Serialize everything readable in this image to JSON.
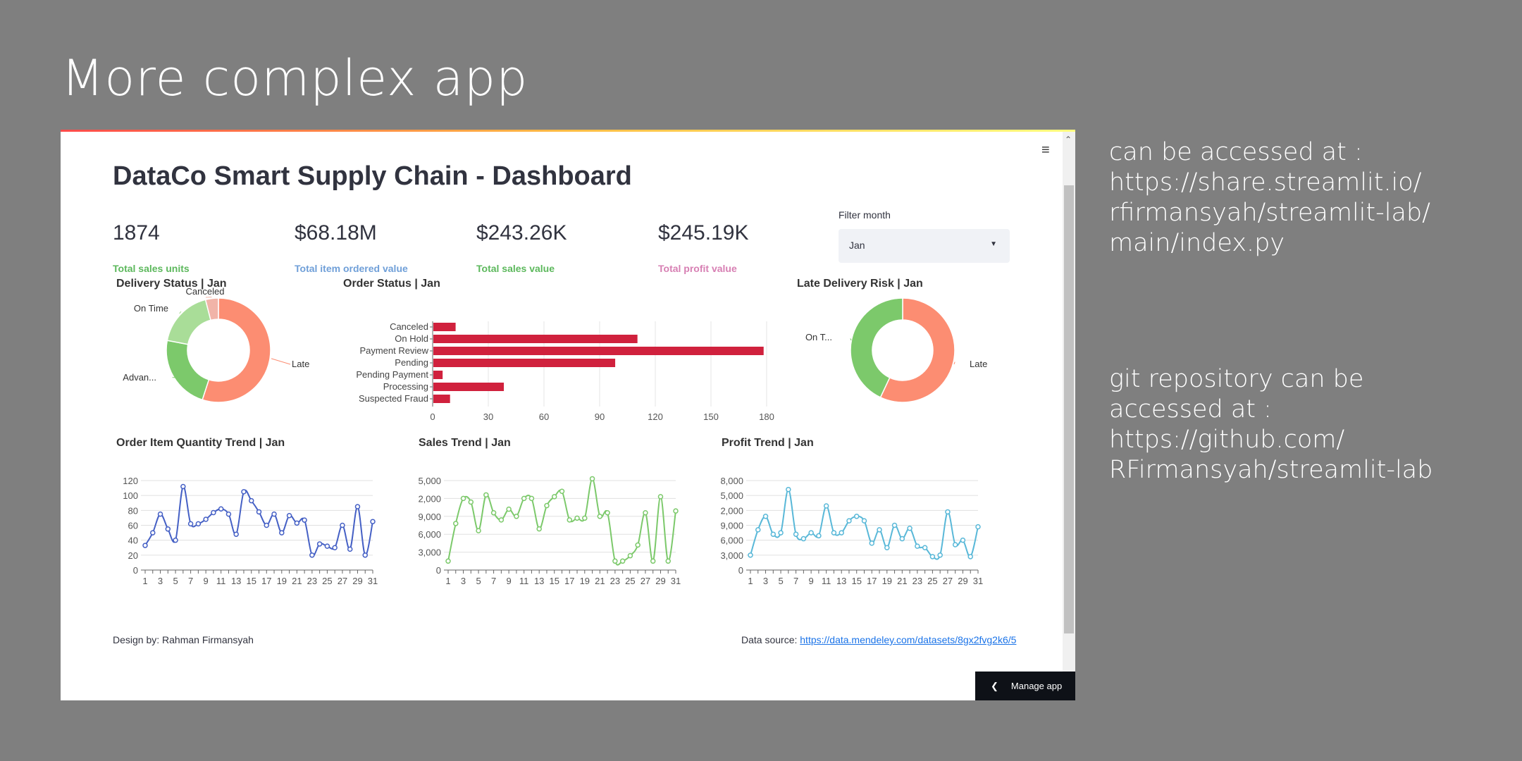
{
  "slide": {
    "title": "More complex app",
    "access_lines": [
      "can be accessed at :",
      "https://share.streamlit.io/",
      "rfirmansyah/streamlit-lab/",
      "main/index.py"
    ],
    "git_lines": [
      "git repository can be",
      "accessed at :",
      "https://github.com/",
      "RFirmansyah/streamlit-lab"
    ]
  },
  "app": {
    "title": "DataCo Smart Supply Chain - Dashboard",
    "menu_icon": "hamburger-menu-icon",
    "metrics": [
      {
        "value": "1874",
        "label": "Total sales units",
        "color": "#5cb85c"
      },
      {
        "value": "$68.18M",
        "label": "Total item ordered value",
        "color": "#6f9fd8"
      },
      {
        "value": "$243.26K",
        "label": "Total sales value",
        "color": "#5cb85c"
      },
      {
        "value": "$245.19K",
        "label": "Total profit value",
        "color": "#d77fb3"
      }
    ],
    "filter": {
      "label": "Filter month",
      "value": "Jan"
    },
    "footer": {
      "design_by": "Design by: Rahman Firmansyah",
      "source_label": "Data source:",
      "source_link": "https://data.mendeley.com/datasets/8gx2fvg2k6/5"
    },
    "manage_app": "Manage app"
  },
  "chart_data": [
    {
      "type": "pie",
      "title": "Delivery Status | Jan",
      "categories": [
        "Late",
        "Advan...",
        "On Time",
        "Canceled"
      ],
      "values": [
        55,
        23,
        18,
        4
      ],
      "colors": [
        "#fc8d72",
        "#7cc96b",
        "#a9dd98",
        "#f1b4a8"
      ]
    },
    {
      "type": "bar",
      "title": "Order Status | Jan",
      "categories": [
        "Canceled",
        "On Hold",
        "Payment Review",
        "Pending",
        "Pending Payment",
        "Processing",
        "Suspected Fraud"
      ],
      "values": [
        12,
        110,
        178,
        98,
        5,
        38,
        9
      ],
      "xticks": [
        "0",
        "30",
        "60",
        "90",
        "120",
        "150",
        "180"
      ],
      "xlim": [
        0,
        180
      ],
      "color": "#d0213d"
    },
    {
      "type": "pie",
      "title": "Late Delivery Risk | Jan",
      "categories": [
        "Late",
        "On T..."
      ],
      "values": [
        57,
        43
      ],
      "colors": [
        "#fc8d72",
        "#7cc96b"
      ]
    },
    {
      "type": "line",
      "title": "Order Item Quantity Trend | Jan",
      "x": [
        "1",
        "2",
        "3",
        "4",
        "5",
        "6",
        "7",
        "8",
        "9",
        "10",
        "11",
        "12",
        "13",
        "14",
        "15",
        "16",
        "17",
        "18",
        "19",
        "20",
        "21",
        "22",
        "23",
        "24",
        "25",
        "26",
        "27",
        "28",
        "29",
        "30",
        "31"
      ],
      "xticks": [
        "1",
        "3",
        "5",
        "7",
        "9",
        "11",
        "13",
        "15",
        "17",
        "19",
        "21",
        "23",
        "25",
        "27",
        "29",
        "31"
      ],
      "yticks": [
        "0",
        "20",
        "40",
        "60",
        "80",
        "100",
        "120"
      ],
      "values": [
        33,
        50,
        75,
        55,
        40,
        112,
        62,
        62,
        68,
        77,
        82,
        75,
        48,
        105,
        93,
        78,
        60,
        75,
        50,
        73,
        63,
        67,
        20,
        35,
        32,
        30,
        60,
        28,
        85,
        20,
        65
      ],
      "ylim": [
        0,
        120
      ],
      "color": "#4560c5"
    },
    {
      "type": "line",
      "title": "Sales Trend | Jan",
      "x": [
        "1",
        "2",
        "3",
        "4",
        "5",
        "6",
        "7",
        "8",
        "9",
        "10",
        "11",
        "12",
        "13",
        "14",
        "15",
        "16",
        "17",
        "18",
        "19",
        "20",
        "21",
        "22",
        "23",
        "24",
        "25",
        "26",
        "27",
        "28",
        "29",
        "30",
        "31"
      ],
      "xticks": [
        "1",
        "3",
        "5",
        "7",
        "9",
        "11",
        "13",
        "15",
        "17",
        "19",
        "21",
        "23",
        "25",
        "27",
        "29",
        "31"
      ],
      "yticks": [
        "0",
        "3,000",
        "6,000",
        "9,000",
        "2,000",
        "5,000"
      ],
      "values": [
        0.5,
        2.6,
        4.0,
        3.8,
        2.2,
        4.2,
        3.2,
        2.8,
        3.4,
        3.0,
        4.0,
        4.0,
        2.3,
        3.6,
        4.1,
        4.4,
        2.8,
        2.9,
        2.9,
        5.1,
        3.0,
        3.2,
        0.5,
        0.5,
        0.8,
        1.4,
        3.2,
        0.5,
        4.1,
        0.5,
        3.3
      ],
      "color": "#7cc96b"
    },
    {
      "type": "line",
      "title": "Profit Trend | Jan",
      "x": [
        "1",
        "2",
        "3",
        "4",
        "5",
        "6",
        "7",
        "8",
        "9",
        "10",
        "11",
        "12",
        "13",
        "14",
        "15",
        "16",
        "17",
        "18",
        "19",
        "20",
        "21",
        "22",
        "23",
        "24",
        "25",
        "26",
        "27",
        "28",
        "29",
        "30",
        "31"
      ],
      "xticks": [
        "1",
        "3",
        "5",
        "7",
        "9",
        "11",
        "13",
        "15",
        "17",
        "19",
        "21",
        "23",
        "25",
        "27",
        "29",
        "31"
      ],
      "yticks": [
        "0",
        "3,000",
        "6,000",
        "9,000",
        "2,000",
        "5,000",
        "8,000"
      ],
      "values": [
        1.0,
        2.7,
        3.6,
        2.4,
        2.5,
        5.4,
        2.4,
        2.1,
        2.5,
        2.3,
        4.3,
        2.5,
        2.5,
        3.3,
        3.6,
        3.3,
        1.8,
        2.7,
        1.5,
        3.0,
        2.1,
        2.8,
        1.6,
        1.5,
        0.9,
        1.0,
        3.9,
        1.7,
        2.0,
        0.9,
        2.9
      ],
      "color": "#59b8d8"
    }
  ]
}
